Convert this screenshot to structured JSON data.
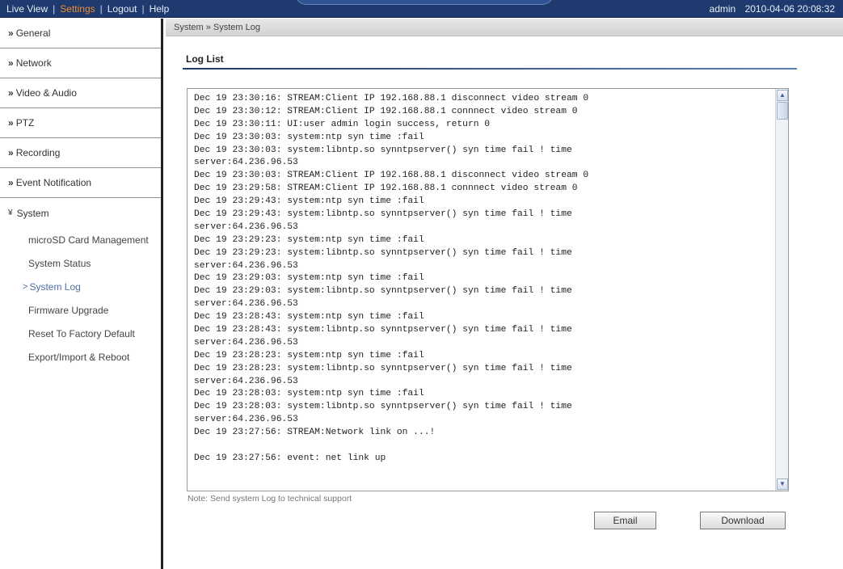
{
  "header": {
    "nav": [
      {
        "label": "Live View",
        "active": false
      },
      {
        "label": "Settings",
        "active": true
      },
      {
        "label": "Logout",
        "active": false
      },
      {
        "label": "Help",
        "active": false
      }
    ],
    "separator": "|",
    "user": "admin",
    "datetime": "2010-04-06 20:08:32"
  },
  "sidebar": {
    "chevron": "»",
    "open_chevron": "¥",
    "items": [
      {
        "label": "General"
      },
      {
        "label": "Network"
      },
      {
        "label": "Video & Audio"
      },
      {
        "label": "PTZ"
      },
      {
        "label": "Recording"
      },
      {
        "label": "Event Notification"
      }
    ],
    "open_item": {
      "label": "System"
    },
    "subitems": [
      {
        "label": "microSD Card Management"
      },
      {
        "label": "System Status"
      },
      {
        "label": "System Log",
        "current": true
      },
      {
        "label": "Firmware Upgrade"
      },
      {
        "label": "Reset To Factory Default"
      },
      {
        "label": "Export/Import & Reboot"
      }
    ],
    "current_marker": ">"
  },
  "breadcrumb": "System » System Log",
  "section_title": "Log List",
  "log_lines": [
    "Dec 19 23:30:16: STREAM:Client IP 192.168.88.1 disconnect video stream 0",
    "Dec 19 23:30:12: STREAM:Client IP 192.168.88.1 connnect video stream 0",
    "Dec 19 23:30:11: UI:user admin login success, return 0",
    "Dec 19 23:30:03: system:ntp syn time :fail",
    "Dec 19 23:30:03: system:libntp.so synntpserver() syn time fail ! time",
    "server:64.236.96.53",
    "Dec 19 23:30:03: STREAM:Client IP 192.168.88.1 disconnect video stream 0",
    "Dec 19 23:29:58: STREAM:Client IP 192.168.88.1 connnect video stream 0",
    "Dec 19 23:29:43: system:ntp syn time :fail",
    "Dec 19 23:29:43: system:libntp.so synntpserver() syn time fail ! time",
    "server:64.236.96.53",
    "Dec 19 23:29:23: system:ntp syn time :fail",
    "Dec 19 23:29:23: system:libntp.so synntpserver() syn time fail ! time",
    "server:64.236.96.53",
    "Dec 19 23:29:03: system:ntp syn time :fail",
    "Dec 19 23:29:03: system:libntp.so synntpserver() syn time fail ! time",
    "server:64.236.96.53",
    "Dec 19 23:28:43: system:ntp syn time :fail",
    "Dec 19 23:28:43: system:libntp.so synntpserver() syn time fail ! time",
    "server:64.236.96.53",
    "Dec 19 23:28:23: system:ntp syn time :fail",
    "Dec 19 23:28:23: system:libntp.so synntpserver() syn time fail ! time",
    "server:64.236.96.53",
    "Dec 19 23:28:03: system:ntp syn time :fail",
    "Dec 19 23:28:03: system:libntp.so synntpserver() syn time fail ! time",
    "server:64.236.96.53",
    "Dec 19 23:27:56: STREAM:Network link on ...!",
    "",
    "Dec 19 23:27:56: event: net link up"
  ],
  "scrollbar": {
    "up_icon": "arrow-up-icon",
    "down_icon": "arrow-down-icon"
  },
  "note": "Note: Send system Log to technical support",
  "buttons": {
    "email": "Email",
    "download": "Download"
  }
}
